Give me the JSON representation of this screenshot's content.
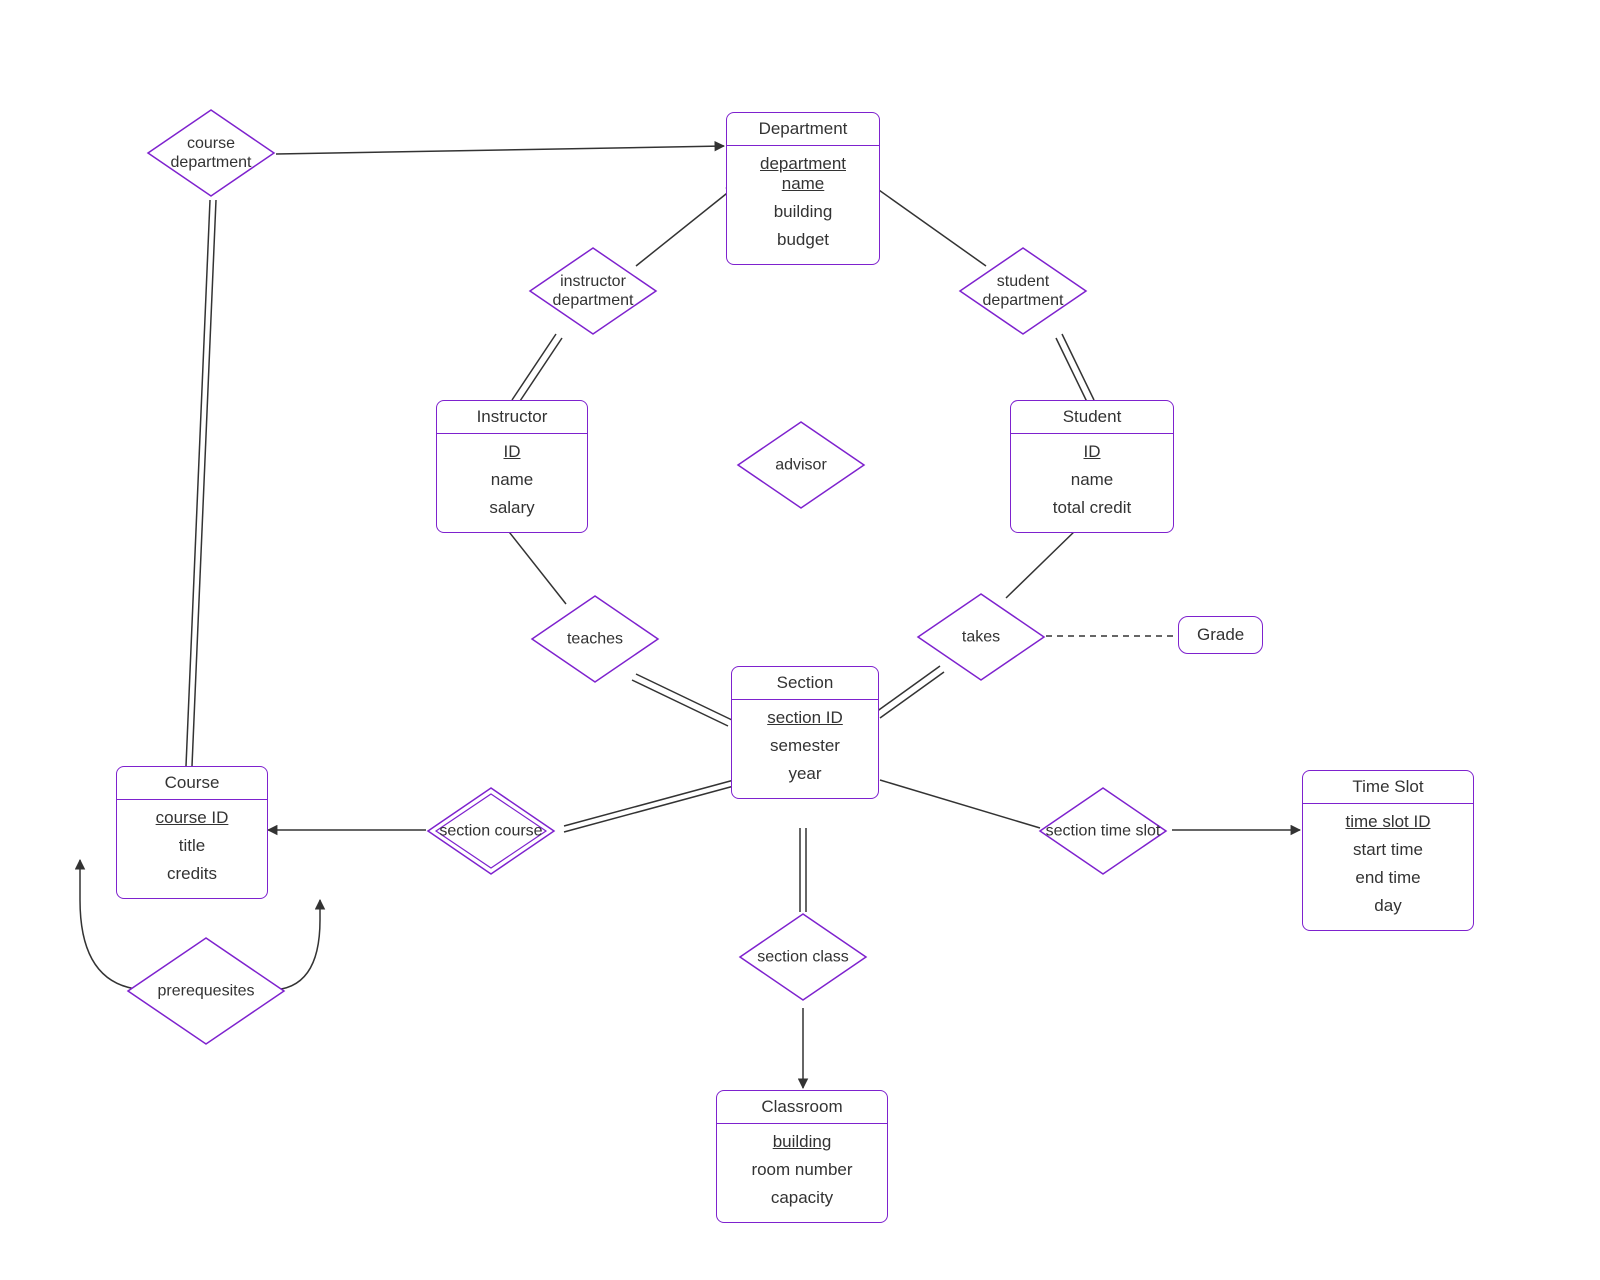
{
  "entities": {
    "department": {
      "title": "Department",
      "key": "department name",
      "attrs": [
        "building",
        "budget"
      ]
    },
    "instructor": {
      "title": "Instructor",
      "key": "ID",
      "attrs": [
        "name",
        "salary"
      ]
    },
    "student": {
      "title": "Student",
      "key": "ID",
      "attrs": [
        "name",
        "total credit"
      ]
    },
    "section": {
      "title": "Section",
      "key": "section ID",
      "attrs": [
        "semester",
        "year"
      ]
    },
    "course": {
      "title": "Course",
      "key": "course ID",
      "attrs": [
        "title",
        "credits"
      ]
    },
    "classroom": {
      "title": "Classroom",
      "key": "building",
      "attrs": [
        "room number",
        "capacity"
      ]
    },
    "timeslot": {
      "title": "Time Slot",
      "key": "time slot ID",
      "attrs": [
        "start time",
        "end time",
        "day"
      ]
    }
  },
  "relationships": {
    "course_department": "course department",
    "instructor_department": "instructor department",
    "student_department": "student department",
    "advisor": "advisor",
    "teaches": "teaches",
    "takes": "takes",
    "section_course": "section course",
    "section_class": "section class",
    "section_timeslot": "section time slot",
    "prerequisites": "prerequesites"
  },
  "extra": {
    "grade": "Grade"
  },
  "colors": {
    "stroke": "#7e22ce",
    "line": "#333333"
  }
}
